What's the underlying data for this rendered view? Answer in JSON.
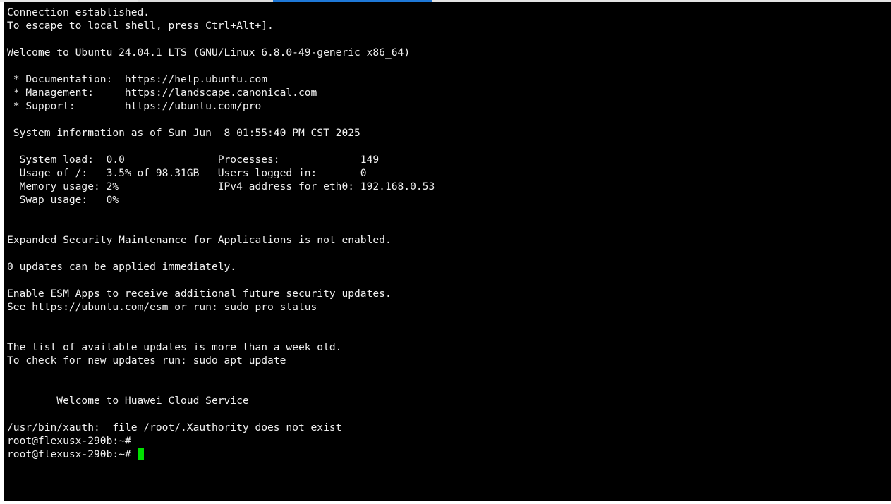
{
  "terminal": {
    "colors": {
      "background": "#000000",
      "foreground": "#f0f0f0",
      "cursor": "#00e000",
      "active_tab_accent": "#1e78d7"
    },
    "lines": [
      "Connection established.",
      "To escape to local shell, press Ctrl+Alt+].",
      "",
      "Welcome to Ubuntu 24.04.1 LTS (GNU/Linux 6.8.0-49-generic x86_64)",
      "",
      " * Documentation:  https://help.ubuntu.com",
      " * Management:     https://landscape.canonical.com",
      " * Support:        https://ubuntu.com/pro",
      "",
      " System information as of Sun Jun  8 01:55:40 PM CST 2025",
      "",
      "  System load:  0.0               Processes:             149",
      "  Usage of /:   3.5% of 98.31GB   Users logged in:       0",
      "  Memory usage: 2%                IPv4 address for eth0: 192.168.0.53",
      "  Swap usage:   0%",
      "",
      "",
      "Expanded Security Maintenance for Applications is not enabled.",
      "",
      "0 updates can be applied immediately.",
      "",
      "Enable ESM Apps to receive additional future security updates.",
      "See https://ubuntu.com/esm or run: sudo pro status",
      "",
      "",
      "The list of available updates is more than a week old.",
      "To check for new updates run: sudo apt update",
      "",
      "",
      "        Welcome to Huawei Cloud Service",
      "",
      "/usr/bin/xauth:  file /root/.Xauthority does not exist",
      "root@flexusx-290b:~#",
      "root@flexusx-290b:~# "
    ]
  }
}
